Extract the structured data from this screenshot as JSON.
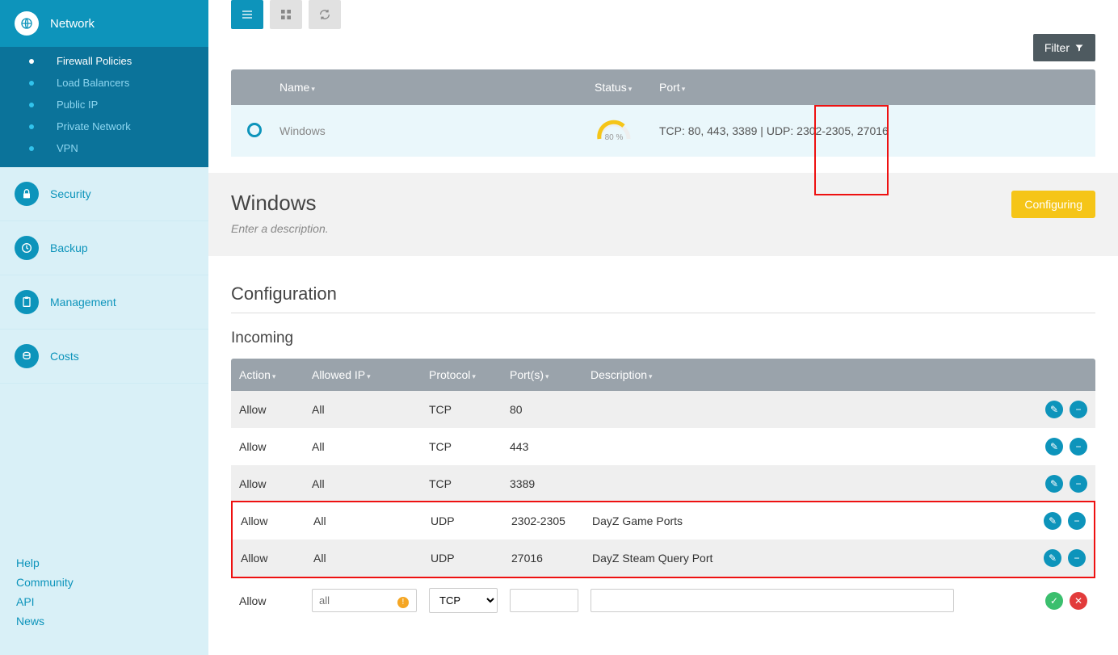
{
  "sidebar": {
    "main_label": "Network",
    "subitems": [
      "Firewall Policies",
      "Load Balancers",
      "Public IP",
      "Private Network",
      "VPN"
    ],
    "active_sub": 0,
    "items": [
      "Security",
      "Backup",
      "Management",
      "Costs"
    ],
    "bottom_links": [
      "Help",
      "Community",
      "API",
      "News"
    ]
  },
  "toolbar": {
    "filter_label": "Filter"
  },
  "grid": {
    "headers": {
      "name": "Name",
      "status": "Status",
      "port": "Port"
    },
    "row": {
      "name": "Windows",
      "status_pct": "80 %",
      "ports": "TCP: 80, 443, 3389 | UDP: 2302-2305, 27016"
    }
  },
  "panel": {
    "title": "Windows",
    "desc_placeholder": "Enter a description.",
    "badge": "Configuring"
  },
  "config": {
    "section_title": "Configuration",
    "incoming_title": "Incoming",
    "headers": {
      "action": "Action",
      "ip": "Allowed IP",
      "proto": "Protocol",
      "ports": "Port(s)",
      "desc": "Description"
    },
    "rows": [
      {
        "action": "Allow",
        "ip": "All",
        "proto": "TCP",
        "ports": "80",
        "desc": ""
      },
      {
        "action": "Allow",
        "ip": "All",
        "proto": "TCP",
        "ports": "443",
        "desc": ""
      },
      {
        "action": "Allow",
        "ip": "All",
        "proto": "TCP",
        "ports": "3389",
        "desc": ""
      },
      {
        "action": "Allow",
        "ip": "All",
        "proto": "UDP",
        "ports": "2302-2305",
        "desc": "DayZ Game Ports"
      },
      {
        "action": "Allow",
        "ip": "All",
        "proto": "UDP",
        "ports": "27016",
        "desc": "DayZ Steam Query Port"
      }
    ],
    "new_row": {
      "action": "Allow",
      "ip_placeholder": "all",
      "proto_default": "TCP"
    }
  }
}
